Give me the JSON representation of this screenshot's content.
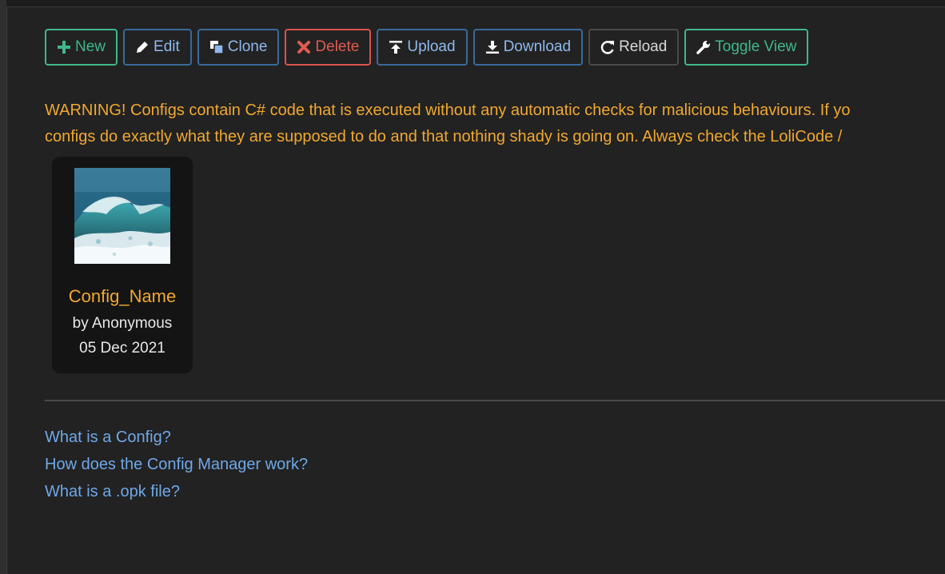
{
  "toolbar": {
    "new_label": "New",
    "edit_label": "Edit",
    "clone_label": "Clone",
    "delete_label": "Delete",
    "upload_label": "Upload",
    "download_label": "Download",
    "reload_label": "Reload",
    "toggle_view_label": "Toggle View"
  },
  "warning": {
    "line1": "WARNING! Configs contain C# code that is executed without any automatic checks for malicious behaviours. If yo",
    "line2": "configs do exactly what they are supposed to do and that nothing shady is going on. Always check the LoliCode /"
  },
  "configs": [
    {
      "name": "Config_Name",
      "author": "by Anonymous",
      "date": "05 Dec 2021",
      "thumbnail": "ocean-wave-image"
    }
  ],
  "help_links": [
    "What is a Config?",
    "How does the Config Manager work?",
    "What is a .opk file?"
  ],
  "colors": {
    "background": "#222222",
    "warning": "#f0a830",
    "link": "#6fa8e8",
    "success": "#3fb88a",
    "danger": "#e05a52",
    "primary_border": "#3a6a9a"
  }
}
